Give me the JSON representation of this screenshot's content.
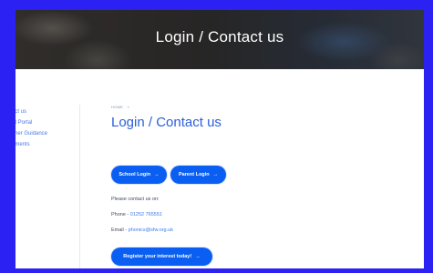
{
  "hero": {
    "title": "Login / Contact us"
  },
  "sidebar": {
    "items": [
      {
        "label": "act us"
      },
      {
        "label": "nt Portal"
      },
      {
        "label": "cher Guidance"
      },
      {
        "label": "uments"
      }
    ]
  },
  "breadcrumb": {
    "home": "HOME",
    "arrow": "»"
  },
  "main": {
    "title": "Login / Contact us",
    "buttons": {
      "school_login": "School Login",
      "parent_login": "Parent Login",
      "register": "Register your interest today!",
      "arrow": "→"
    },
    "contact": {
      "intro": "Please contact us on:",
      "phone_label": "Phone - ",
      "phone_value": "01252 765551",
      "email_label": "Email - ",
      "email_value": "phonics@sfw.org.uk"
    }
  },
  "colors": {
    "page_background": "#2b21f2",
    "button": "#0a5ff2",
    "title": "#2b5fd9",
    "link": "#3c7be8"
  }
}
